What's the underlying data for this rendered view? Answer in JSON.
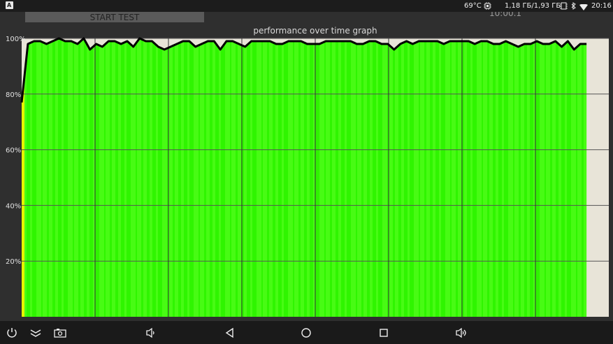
{
  "status_bar": {
    "temperature": "69°C",
    "memory": "1,18 ГБ/1,93 ГБ",
    "time": "20:16"
  },
  "app": {
    "start_button_label": "START TEST",
    "timer_text": "10:00.1",
    "graph_title": "performance over time graph"
  },
  "chart_data": {
    "type": "area",
    "title": "performance over time graph",
    "xlabel": "",
    "ylabel": "",
    "ylim": [
      0,
      100
    ],
    "y_ticks": [
      "100%",
      "80%",
      "60%",
      "40%",
      "20%"
    ],
    "y_tick_values": [
      100,
      80,
      60,
      40,
      20
    ],
    "grid": true,
    "x_divisions": 8,
    "x_filled_fraction": 0.962,
    "series": [
      {
        "values": [
          77,
          98,
          99,
          99,
          98,
          99,
          100,
          99,
          99,
          98,
          100,
          96,
          98,
          97,
          99,
          99,
          98,
          99,
          97,
          100,
          99,
          99,
          97,
          96,
          97,
          98,
          99,
          99,
          97,
          98,
          99,
          99,
          96,
          99,
          99,
          98,
          97,
          99,
          99,
          99,
          99,
          98,
          98,
          99,
          99,
          99,
          98,
          98,
          98,
          99,
          99,
          99,
          99,
          99,
          98,
          98,
          99,
          99,
          98,
          98,
          96,
          98,
          99,
          98,
          99,
          99,
          99,
          99,
          98,
          99,
          99,
          99,
          99,
          98,
          99,
          99,
          98,
          98,
          99,
          98,
          97,
          98,
          98,
          99,
          98,
          98,
          99,
          97,
          99,
          96,
          98,
          98
        ]
      }
    ],
    "colors": {
      "fill": "#2ff500",
      "fill_light": "#5cff24",
      "start_fill": "#e5f500",
      "line": "#000000",
      "background": "#e8e4d8"
    }
  },
  "nav_bar": {
    "icons": [
      "power-icon",
      "expand-icon",
      "screenshot-icon",
      "volume-down-icon",
      "back-icon",
      "home-icon",
      "recents-icon",
      "volume-up-icon"
    ]
  }
}
